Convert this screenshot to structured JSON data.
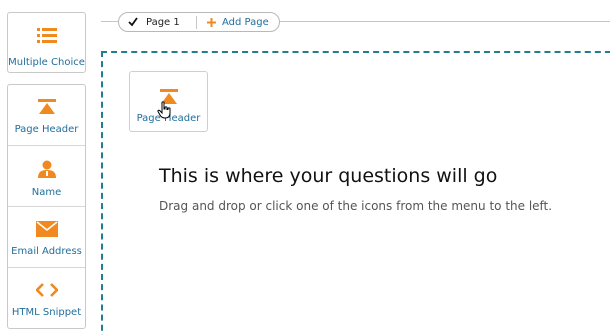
{
  "palette": {
    "top": {
      "label": "Multiple Choice",
      "icon": "list-icon"
    },
    "items": [
      {
        "label": "Page Header",
        "icon": "page-header-icon"
      },
      {
        "label": "Name",
        "icon": "person-icon"
      },
      {
        "label": "Email Address",
        "icon": "envelope-icon"
      },
      {
        "label": "HTML Snippet",
        "icon": "code-icon"
      }
    ]
  },
  "tabs": {
    "current_page": "Page 1",
    "add_page": "Add Page"
  },
  "canvas": {
    "drag_item_label": "Page Header",
    "empty_title": "This is where your questions will go",
    "empty_subtitle": "Drag and drop or click one of the icons from the menu to the left."
  },
  "colors": {
    "accent_orange": "#f0891f",
    "link_blue": "#1f6e9c",
    "dashed_border": "#1f7f8c"
  }
}
